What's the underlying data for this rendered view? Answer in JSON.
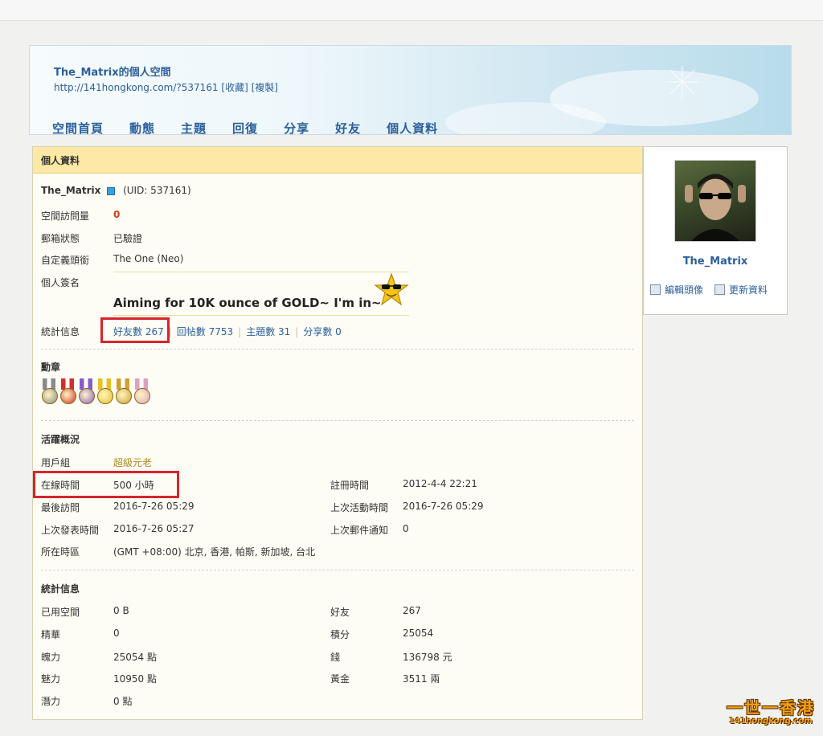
{
  "header": {
    "title": "The_Matrix的個人空間",
    "url": "http://141hongkong.com/?537161",
    "bookmark": "[收藏]",
    "copy": "[複製]"
  },
  "nav": [
    "空間首頁",
    "動態",
    "主題",
    "回復",
    "分享",
    "好友",
    "個人資料"
  ],
  "profile": {
    "section_title": "個人資料",
    "username": "The_Matrix",
    "uid": "(UID: 537161)",
    "visits_label": "空間訪問量",
    "visits_value": "0",
    "email_label": "郵箱狀態",
    "email_value": "已驗證",
    "custom_title_label": "自定義頭銜",
    "custom_title_value": "The One (Neo)",
    "signature_label": "個人簽名",
    "signature_text": "Aiming for 10K ounce of GOLD~ I'm in~",
    "stats_label": "統計信息",
    "stats_links": [
      "好友數 267",
      "回帖數 7753",
      "主題數 31",
      "分享數 0"
    ]
  },
  "medals": {
    "title": "勳章",
    "colors": [
      "#8a8a8a",
      "#d0302a",
      "#8a5ac8",
      "#e8c020",
      "#d0a030",
      "#e0a0c0"
    ]
  },
  "activity": {
    "title": "活躍概況",
    "usergroup_label": "用戶組",
    "usergroup_value": "超級元老",
    "usergroup_color": "#b08a1e",
    "rows": [
      {
        "l1": "在線時間",
        "v1": "500 小時",
        "l2": "註冊時間",
        "v2": "2012-4-4 22:21"
      },
      {
        "l1": "最後訪問",
        "v1": "2016-7-26 05:29",
        "l2": "上次活動時間",
        "v2": "2016-7-26 05:29"
      },
      {
        "l1": "上次發表時間",
        "v1": "2016-7-26 05:27",
        "l2": "上次郵件通知",
        "v2": "0"
      }
    ],
    "timezone_label": "所在時區",
    "timezone_value": "(GMT +08:00) 北京, 香港, 帕斯, 新加坡, 台北"
  },
  "statistics": {
    "title": "統計信息",
    "rows": [
      {
        "l1": "已用空間",
        "v1": "0 B",
        "l2": "好友",
        "v2": "267"
      },
      {
        "l1": "精華",
        "v1": "0",
        "l2": "積分",
        "v2": "25054"
      },
      {
        "l1": "魄力",
        "v1": "25054 點",
        "l2": "錢",
        "v2": "136798 元"
      },
      {
        "l1": "魅力",
        "v1": "10950 點",
        "l2": "黃金",
        "v2": "3511 兩"
      },
      {
        "l1": "潛力",
        "v1": "0 點",
        "l2": "",
        "v2": ""
      }
    ]
  },
  "sidebar": {
    "name": "The_Matrix",
    "edit_avatar": "編輯頭像",
    "update_profile": "更新資料"
  },
  "watermark": {
    "line1": "一世一香港",
    "line2": "141hongkong.com"
  }
}
